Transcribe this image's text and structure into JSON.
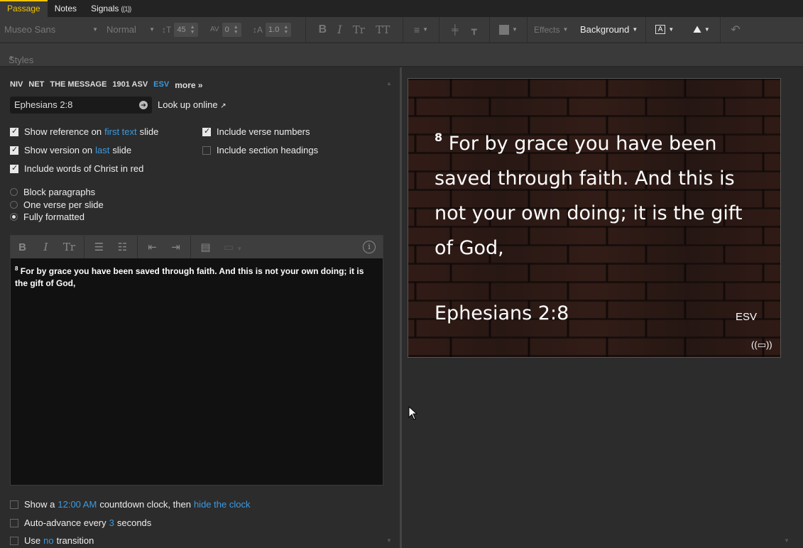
{
  "tabs": [
    {
      "label": "Passage",
      "active": true
    },
    {
      "label": "Notes",
      "active": false
    },
    {
      "label": "Signals",
      "active": false,
      "suffix": "((1))"
    }
  ],
  "toolbar": {
    "font": "Museo Sans",
    "weight": "Normal",
    "font_size": "45",
    "tracking": "0",
    "line_height": "1.0",
    "effects": "Effects",
    "background": "Background"
  },
  "styles_label": "Styles",
  "versions": [
    "NIV",
    "NET",
    "THE MESSAGE",
    "1901 ASV",
    "ESV"
  ],
  "active_version": "ESV",
  "more_label": "more »",
  "reference_input": "Ephesians 2:8",
  "lookup_label": "Look up online",
  "options": {
    "show_ref_pre": "Show reference on",
    "show_ref_link": "first text",
    "show_ref_post": "slide",
    "show_ver_pre": "Show version on",
    "show_ver_link": "last",
    "show_ver_post": "slide",
    "words_christ": "Include words of Christ in red",
    "verse_numbers": "Include verse numbers",
    "section_headings": "Include section headings"
  },
  "radios": {
    "block": "Block paragraphs",
    "one_verse": "One verse per slide",
    "fully": "Fully formatted"
  },
  "editor": {
    "verse_num": "8",
    "text": "For by grace you have been saved through faith. And this is not your own doing; it is the gift of God,"
  },
  "bottom": {
    "clock_pre": "Show a",
    "clock_time": "12:00 AM",
    "clock_mid": "countdown clock, then",
    "clock_link": "hide the clock",
    "advance_pre": "Auto-advance every",
    "advance_num": "3",
    "advance_post": "seconds",
    "transition_pre": "Use",
    "transition_link": "no",
    "transition_post": "transition"
  },
  "slide": {
    "verse_num": "8",
    "text": "For by grace you have been saved through faith. And this is not your own doing; it is the gift of God,",
    "reference": "Ephesians 2:8",
    "version": "ESV"
  },
  "colors": {
    "accent": "#3b9ae1",
    "tab_active": "#f0c400"
  }
}
